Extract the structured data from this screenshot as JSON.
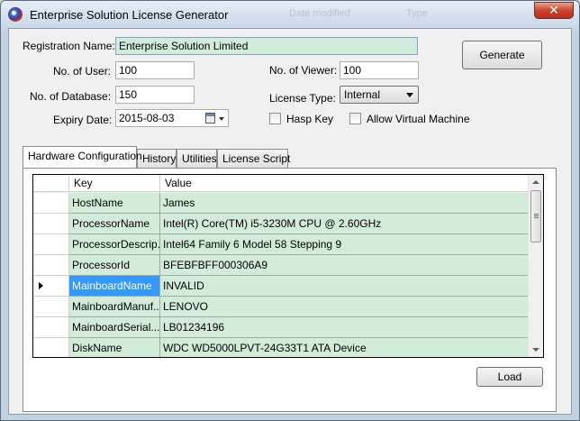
{
  "window": {
    "title": "Enterprise Solution License Generator",
    "ghost_texts": [
      "Date modified",
      "Type"
    ]
  },
  "form": {
    "registration_name_label": "Registration Name:",
    "registration_name_value": "Enterprise Solution Limited",
    "no_of_user_label": "No. of User:",
    "no_of_user_value": "100",
    "no_of_viewer_label": "No. of Viewer:",
    "no_of_viewer_value": "100",
    "no_of_database_label": "No. of Database:",
    "no_of_database_value": "150",
    "license_type_label": "License Type:",
    "license_type_value": "Internal",
    "expiry_date_label": "Expiry Date:",
    "expiry_date_value": "2015-08-03",
    "hasp_key_label": "Hasp Key",
    "allow_vm_label": "Allow Virtual Machine",
    "generate_label": "Generate",
    "load_label": "Load"
  },
  "tabs": [
    "Hardware Configuration",
    "History",
    "Utilities",
    "License Script"
  ],
  "grid": {
    "columns": [
      "Key",
      "Value"
    ],
    "rows": [
      {
        "key": "HostName",
        "value": "James"
      },
      {
        "key": "ProcessorName",
        "value": "Intel(R) Core(TM) i5-3230M CPU @ 2.60GHz"
      },
      {
        "key": "ProcessorDescrip...",
        "value": "Intel64 Family 6 Model 58 Stepping 9"
      },
      {
        "key": "ProcessorId",
        "value": "BFEBFBFF000306A9"
      },
      {
        "key": "MainboardName",
        "value": "INVALID"
      },
      {
        "key": "MainboardManuf...",
        "value": "LENOVO"
      },
      {
        "key": "MainboardSerial...",
        "value": "LB01234196"
      },
      {
        "key": "DiskName",
        "value": "WDC WD5000LPVT-24G33T1 ATA Device"
      }
    ]
  },
  "icons": {
    "app": "app-logo-icon",
    "close": "close-icon",
    "calendar": "calendar-icon",
    "combo_arrow": "chevron-down-icon",
    "row_pointer": "current-row-pointer-icon"
  },
  "colors": {
    "grid_cell": "#d2ecd9",
    "selection": "#3399ff",
    "close_button": "#c8452e"
  }
}
